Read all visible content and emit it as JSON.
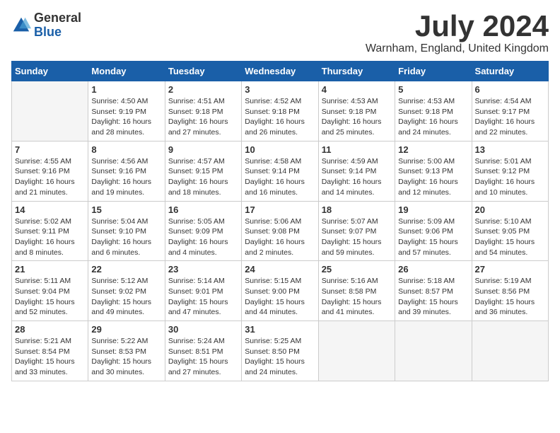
{
  "logo": {
    "general": "General",
    "blue": "Blue"
  },
  "title": "July 2024",
  "location": "Warnham, England, United Kingdom",
  "days_of_week": [
    "Sunday",
    "Monday",
    "Tuesday",
    "Wednesday",
    "Thursday",
    "Friday",
    "Saturday"
  ],
  "weeks": [
    [
      {
        "day": "",
        "info": ""
      },
      {
        "day": "1",
        "info": "Sunrise: 4:50 AM\nSunset: 9:19 PM\nDaylight: 16 hours\nand 28 minutes."
      },
      {
        "day": "2",
        "info": "Sunrise: 4:51 AM\nSunset: 9:18 PM\nDaylight: 16 hours\nand 27 minutes."
      },
      {
        "day": "3",
        "info": "Sunrise: 4:52 AM\nSunset: 9:18 PM\nDaylight: 16 hours\nand 26 minutes."
      },
      {
        "day": "4",
        "info": "Sunrise: 4:53 AM\nSunset: 9:18 PM\nDaylight: 16 hours\nand 25 minutes."
      },
      {
        "day": "5",
        "info": "Sunrise: 4:53 AM\nSunset: 9:18 PM\nDaylight: 16 hours\nand 24 minutes."
      },
      {
        "day": "6",
        "info": "Sunrise: 4:54 AM\nSunset: 9:17 PM\nDaylight: 16 hours\nand 22 minutes."
      }
    ],
    [
      {
        "day": "7",
        "info": "Sunrise: 4:55 AM\nSunset: 9:16 PM\nDaylight: 16 hours\nand 21 minutes."
      },
      {
        "day": "8",
        "info": "Sunrise: 4:56 AM\nSunset: 9:16 PM\nDaylight: 16 hours\nand 19 minutes."
      },
      {
        "day": "9",
        "info": "Sunrise: 4:57 AM\nSunset: 9:15 PM\nDaylight: 16 hours\nand 18 minutes."
      },
      {
        "day": "10",
        "info": "Sunrise: 4:58 AM\nSunset: 9:14 PM\nDaylight: 16 hours\nand 16 minutes."
      },
      {
        "day": "11",
        "info": "Sunrise: 4:59 AM\nSunset: 9:14 PM\nDaylight: 16 hours\nand 14 minutes."
      },
      {
        "day": "12",
        "info": "Sunrise: 5:00 AM\nSunset: 9:13 PM\nDaylight: 16 hours\nand 12 minutes."
      },
      {
        "day": "13",
        "info": "Sunrise: 5:01 AM\nSunset: 9:12 PM\nDaylight: 16 hours\nand 10 minutes."
      }
    ],
    [
      {
        "day": "14",
        "info": "Sunrise: 5:02 AM\nSunset: 9:11 PM\nDaylight: 16 hours\nand 8 minutes."
      },
      {
        "day": "15",
        "info": "Sunrise: 5:04 AM\nSunset: 9:10 PM\nDaylight: 16 hours\nand 6 minutes."
      },
      {
        "day": "16",
        "info": "Sunrise: 5:05 AM\nSunset: 9:09 PM\nDaylight: 16 hours\nand 4 minutes."
      },
      {
        "day": "17",
        "info": "Sunrise: 5:06 AM\nSunset: 9:08 PM\nDaylight: 16 hours\nand 2 minutes."
      },
      {
        "day": "18",
        "info": "Sunrise: 5:07 AM\nSunset: 9:07 PM\nDaylight: 15 hours\nand 59 minutes."
      },
      {
        "day": "19",
        "info": "Sunrise: 5:09 AM\nSunset: 9:06 PM\nDaylight: 15 hours\nand 57 minutes."
      },
      {
        "day": "20",
        "info": "Sunrise: 5:10 AM\nSunset: 9:05 PM\nDaylight: 15 hours\nand 54 minutes."
      }
    ],
    [
      {
        "day": "21",
        "info": "Sunrise: 5:11 AM\nSunset: 9:04 PM\nDaylight: 15 hours\nand 52 minutes."
      },
      {
        "day": "22",
        "info": "Sunrise: 5:12 AM\nSunset: 9:02 PM\nDaylight: 15 hours\nand 49 minutes."
      },
      {
        "day": "23",
        "info": "Sunrise: 5:14 AM\nSunset: 9:01 PM\nDaylight: 15 hours\nand 47 minutes."
      },
      {
        "day": "24",
        "info": "Sunrise: 5:15 AM\nSunset: 9:00 PM\nDaylight: 15 hours\nand 44 minutes."
      },
      {
        "day": "25",
        "info": "Sunrise: 5:16 AM\nSunset: 8:58 PM\nDaylight: 15 hours\nand 41 minutes."
      },
      {
        "day": "26",
        "info": "Sunrise: 5:18 AM\nSunset: 8:57 PM\nDaylight: 15 hours\nand 39 minutes."
      },
      {
        "day": "27",
        "info": "Sunrise: 5:19 AM\nSunset: 8:56 PM\nDaylight: 15 hours\nand 36 minutes."
      }
    ],
    [
      {
        "day": "28",
        "info": "Sunrise: 5:21 AM\nSunset: 8:54 PM\nDaylight: 15 hours\nand 33 minutes."
      },
      {
        "day": "29",
        "info": "Sunrise: 5:22 AM\nSunset: 8:53 PM\nDaylight: 15 hours\nand 30 minutes."
      },
      {
        "day": "30",
        "info": "Sunrise: 5:24 AM\nSunset: 8:51 PM\nDaylight: 15 hours\nand 27 minutes."
      },
      {
        "day": "31",
        "info": "Sunrise: 5:25 AM\nSunset: 8:50 PM\nDaylight: 15 hours\nand 24 minutes."
      },
      {
        "day": "",
        "info": ""
      },
      {
        "day": "",
        "info": ""
      },
      {
        "day": "",
        "info": ""
      }
    ]
  ]
}
